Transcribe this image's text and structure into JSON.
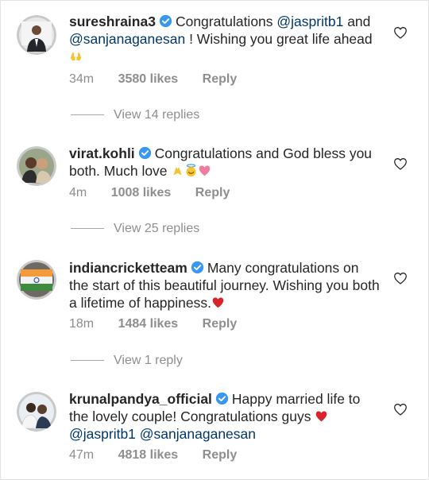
{
  "comments": [
    {
      "username": "sureshraina3",
      "parts": [
        "Congratulations ",
        "@jaspritb1",
        " and ",
        "@sanjanaganesan",
        " ! Wishing you great life ahead "
      ],
      "time": "34m",
      "likes": "3580 likes",
      "reply_label": "Reply",
      "avatar_icon": "man-in-suit-avatar",
      "emoji_icon": "raising-hands-icon"
    },
    {
      "username": "virat.kohli",
      "parts": [
        "Congratulations and God bless you both. Much love "
      ],
      "time": "4m",
      "likes": "1008 likes",
      "reply_label": "Reply",
      "avatar_icon": "couple-avatar",
      "emoji_icons": [
        "folded-hands-icon",
        "smiling-halo-icon",
        "sparkling-heart-icon"
      ]
    },
    {
      "username": "indiancricketteam",
      "parts": [
        "Many congratulations on the start of this beautiful journey. Wishing you both a lifetime of happiness."
      ],
      "time": "18m",
      "likes": "1484 likes",
      "reply_label": "Reply",
      "avatar_icon": "indian-flag-team-avatar",
      "emoji_icon": "red-heart-icon"
    },
    {
      "username": "krunalpandya_official",
      "parts": [
        "Happy married life to the lovely couple! Congratulations guys ",
        "@jaspritb1",
        " ",
        "@sanjanaganesan"
      ],
      "time": "47m",
      "likes": "4818 likes",
      "reply_label": "Reply",
      "avatar_icon": "two-men-avatar",
      "emoji_icon": "red-heart-icon"
    }
  ],
  "view_replies": [
    "View 14 replies",
    "View 25 replies",
    "View 1 reply"
  ],
  "colors": {
    "text": "#262626",
    "muted": "#8e8e8e",
    "mention": "#00376b",
    "verified": "#3897f0",
    "heart": "#ed2a2a"
  }
}
